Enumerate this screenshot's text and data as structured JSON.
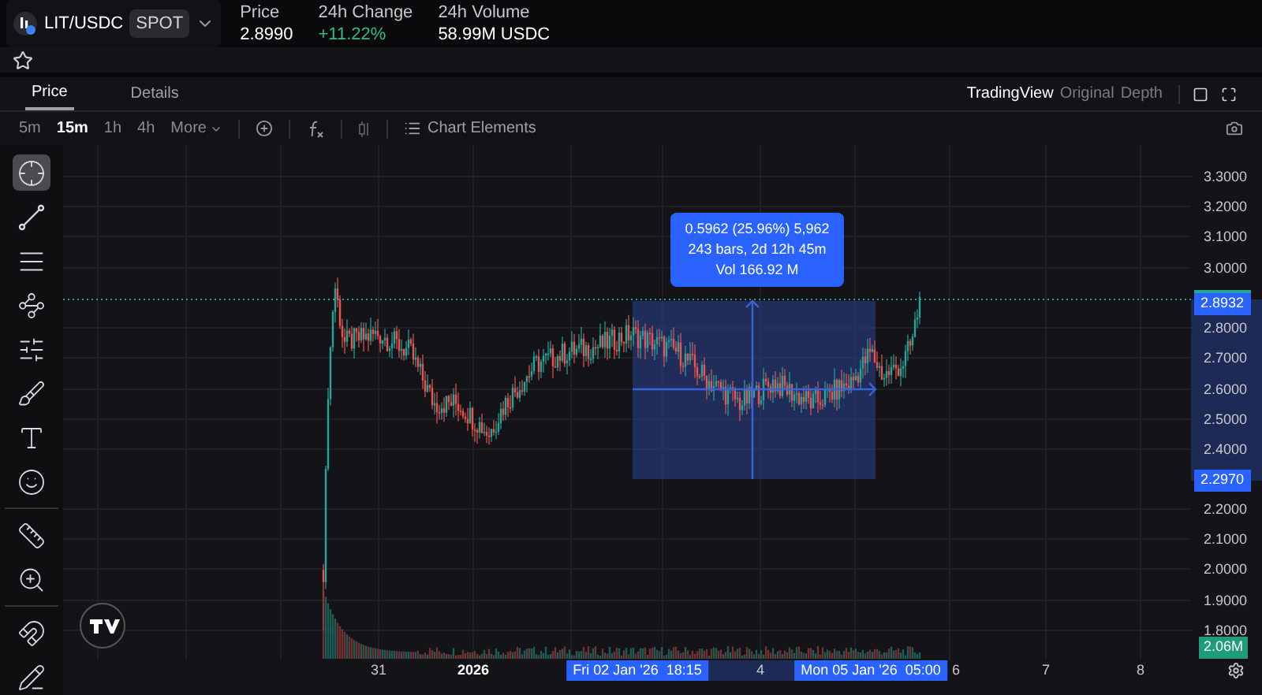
{
  "header": {
    "pair": "LIT/USDC",
    "market_type": "SPOT",
    "stats": [
      {
        "label": "Price",
        "value": "2.8990",
        "kind": "plain"
      },
      {
        "label": "24h Change",
        "value": "+11.22%",
        "kind": "up"
      },
      {
        "label": "24h Volume",
        "value": "58.99M USDC",
        "kind": "plain"
      }
    ]
  },
  "favorite": {
    "starred": false
  },
  "tabs": [
    {
      "label": "Price",
      "selected": true
    },
    {
      "label": "Details",
      "selected": false
    }
  ],
  "view_modes": [
    {
      "label": "TradingView",
      "selected": true
    },
    {
      "label": "Original",
      "selected": false
    },
    {
      "label": "Depth",
      "selected": false
    }
  ],
  "intervals": [
    {
      "label": "5m",
      "selected": false
    },
    {
      "label": "15m",
      "selected": true
    },
    {
      "label": "1h",
      "selected": false
    },
    {
      "label": "4h",
      "selected": false
    }
  ],
  "more_menu": "More",
  "chart_elements": "Chart Elements",
  "tools": [
    {
      "kind": "crosshair",
      "selected": true
    },
    {
      "kind": "trend-line",
      "selected": false
    },
    {
      "kind": "lines",
      "selected": false
    },
    {
      "kind": "pattern",
      "selected": false
    },
    {
      "kind": "projection",
      "selected": false
    },
    {
      "kind": "brush",
      "selected": false
    },
    {
      "kind": "text",
      "selected": false
    },
    {
      "kind": "emoji",
      "selected": false
    },
    {
      "kind": "ruler",
      "selected": false
    },
    {
      "kind": "zoom",
      "selected": false
    },
    {
      "kind": "magnet",
      "selected": false
    },
    {
      "kind": "lock",
      "selected": false
    }
  ],
  "price_axis": [
    "3.3000",
    "3.2000",
    "3.1000",
    "3.0000",
    "2.8000",
    "2.7000",
    "2.6000",
    "2.5000",
    "2.4000",
    "2.2000",
    "2.1000",
    "2.0000",
    "1.9000",
    "1.8000"
  ],
  "price_markers": [
    {
      "label": "2.8932",
      "kind": "last"
    },
    {
      "label": "2.2970",
      "kind": "range"
    }
  ],
  "volume_marker": "2.06M",
  "measure": {
    "lines": [
      "0.5962 (25.96%) 5,962",
      "243 bars, 2d 12h 45m",
      "Vol 166.92 M"
    ]
  },
  "time_axis": [
    {
      "label": "31",
      "kind": "tick"
    },
    {
      "label": "2026",
      "kind": "bold"
    },
    {
      "label": "Fri 02 Jan '26  18:15",
      "kind": "highlight"
    },
    {
      "label": "4",
      "kind": "tick"
    },
    {
      "label": "Mon 05 Jan '26  05:00",
      "kind": "highlight"
    },
    {
      "label": "6",
      "kind": "tick"
    },
    {
      "label": "7",
      "kind": "tick"
    },
    {
      "label": "8",
      "kind": "tick"
    }
  ]
}
